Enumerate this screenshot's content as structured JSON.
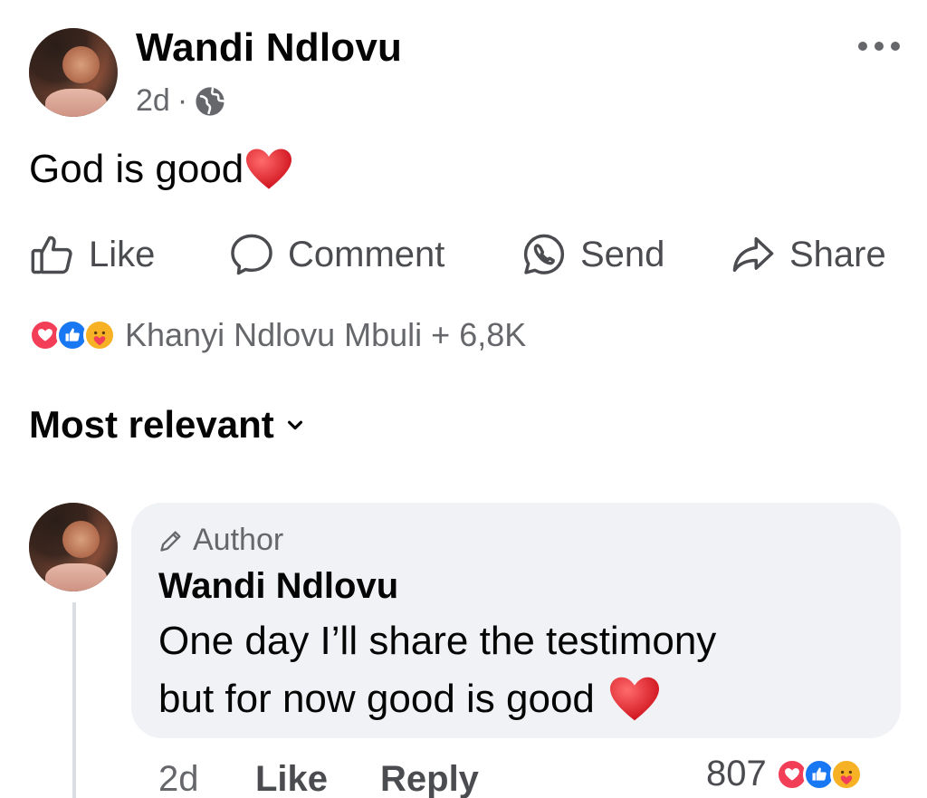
{
  "post": {
    "author": "Wandi Ndlovu",
    "time": "2d",
    "separator": "·",
    "privacy_icon": "globe-icon",
    "text": "God is good",
    "text_emoji": "red-heart"
  },
  "actions": {
    "like": "Like",
    "comment": "Comment",
    "send": "Send",
    "share": "Share"
  },
  "reactions": {
    "icons": [
      "love",
      "like",
      "care"
    ],
    "names": "Khanyi Ndlovu Mbuli + 6,8K"
  },
  "comments_section": {
    "sort_label": "Most relevant"
  },
  "comment": {
    "badge": "Author",
    "author": "Wandi Ndlovu",
    "line1": "One day I’ll share the testimony",
    "line2": "but for now good is good",
    "emoji": "red-heart",
    "time": "2d",
    "like_label": "Like",
    "reply_label": "Reply",
    "reaction_count": "807",
    "reaction_icons": [
      "love",
      "like",
      "care"
    ]
  },
  "colors": {
    "text_primary": "#050505",
    "text_secondary": "#65676b",
    "bubble_bg": "#f0f2f5",
    "love": "#f33e58",
    "like": "#1877f2",
    "care": "#f7b125"
  }
}
